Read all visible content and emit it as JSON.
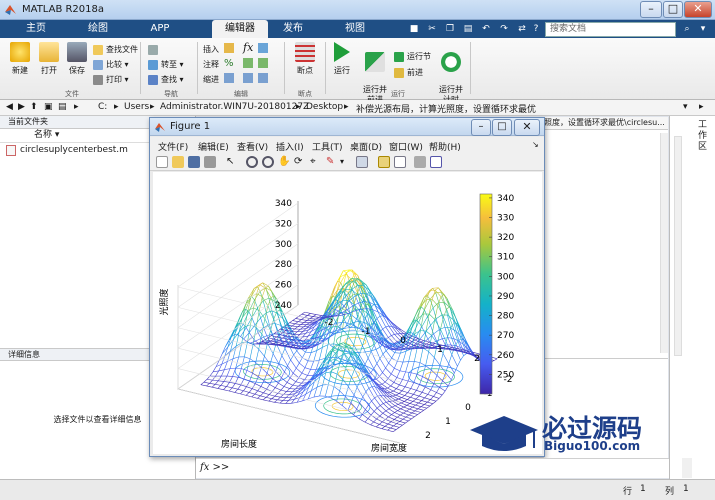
{
  "window": {
    "title": "MATLAB R2018a",
    "minimize": "–",
    "maximize": "□",
    "close": "✕"
  },
  "tabs": [
    {
      "label": "主页"
    },
    {
      "label": "绘图"
    },
    {
      "label": "APP"
    },
    {
      "label": "编辑器"
    },
    {
      "label": "发布"
    },
    {
      "label": "视图"
    }
  ],
  "search": {
    "placeholder": "搜索文档"
  },
  "ribbon": {
    "file": {
      "new": "新建",
      "open": "打开",
      "save": "保存",
      "find_files": "查找文件",
      "compare": "比较",
      "print": "打印",
      "group": "文件"
    },
    "navigate": {
      "goto": "转至",
      "find": "查找",
      "group": "导航"
    },
    "edit": {
      "insert": "插入",
      "comment": "注释",
      "indent": "缩进",
      "group": "编辑"
    },
    "breakpoints": {
      "label": "断点",
      "group": "断点"
    },
    "run": {
      "run": "运行",
      "run_advance": "运行并\n前进",
      "run_section": "运行节",
      "advance": "前进",
      "run_time": "运行并\n计时",
      "group": "运行"
    }
  },
  "address": {
    "segments": [
      "C:",
      "Users",
      "Administrator.WIN7U-20180127Z",
      "Desktop",
      "补偿光源布局，计算光照度，设置循环求最优"
    ],
    "sep": "▸"
  },
  "current_folder": {
    "title": "当前文件夹",
    "column": "名称 ▾",
    "files": [
      "circlesuplycenterbest.m"
    ]
  },
  "details": {
    "title": "详细信息",
    "hint": "选择文件以查看详细信息"
  },
  "editor_tab_partial": "照度，设置循环求最优\\circlesu...",
  "workspace_title": "工作区",
  "figure": {
    "title": "Figure 1",
    "menu": [
      "文件(F)",
      "编辑(E)",
      "查看(V)",
      "插入(I)",
      "工具(T)",
      "桌面(D)",
      "窗口(W)",
      "帮助(H)"
    ]
  },
  "chart_data": {
    "type": "surface",
    "title": "",
    "xlabel": "房间长度",
    "ylabel": "房间宽度",
    "zlabel": "光照度",
    "zticks": [
      240,
      260,
      280,
      300,
      320,
      340
    ],
    "xticks": [
      -2,
      -1,
      0,
      1,
      2
    ],
    "yticks": [
      -2,
      -1,
      0,
      1,
      2
    ],
    "colorbar": {
      "ticks": [
        250,
        260,
        270,
        280,
        290,
        300,
        310,
        320,
        330,
        340
      ],
      "range": [
        240,
        342
      ]
    },
    "zlim": [
      240,
      342
    ],
    "peaks": [
      {
        "x": 0,
        "y": 0,
        "z": 342
      },
      {
        "x": -1.8,
        "y": 1.0,
        "z": 325
      },
      {
        "x": 1.8,
        "y": -1.0,
        "z": 325
      },
      {
        "x": 0.8,
        "y": 1.8,
        "z": 300
      },
      {
        "x": -0.8,
        "y": -1.8,
        "z": 300
      }
    ],
    "colormap": "parula",
    "contour_base": true
  },
  "command": {
    "prompt": "fx  >>"
  },
  "status": {
    "row_label": "行",
    "row": "1",
    "col_label": "列",
    "col": "1"
  },
  "watermark": {
    "text": "必过源码",
    "url": "Biguo100.com"
  }
}
